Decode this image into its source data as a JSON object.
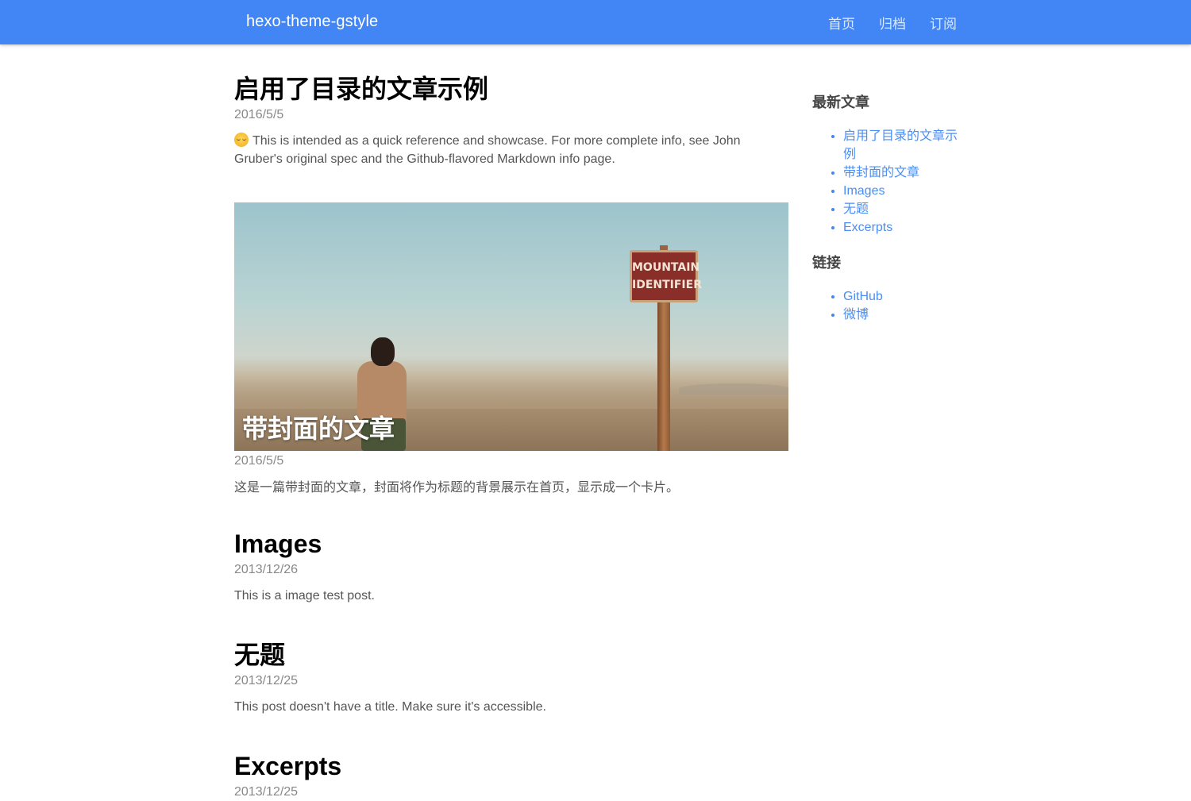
{
  "header": {
    "brand": "hexo-theme-gstyle",
    "nav": [
      "首页",
      "归档",
      "订阅"
    ],
    "accent_color": "#4285f4"
  },
  "posts": [
    {
      "title": "启用了目录的文章示例",
      "date": "2016/5/5",
      "excerpt": "This is intended as a quick reference and showcase. For more complete info, see John Gruber's original spec and the Github-flavored Markdown info page.",
      "emoji_icon": "relieved-face-icon"
    },
    {
      "title": "带封面的文章",
      "date": "2016/5/5",
      "excerpt": "这是一篇带封面的文章，封面将作为标题的背景展示在首页，显示成一个卡片。",
      "cover": {
        "sign_line1": "MOUNTAIN",
        "sign_line2": "IDENTIFIER"
      }
    },
    {
      "title": "Images",
      "date": "2013/12/26",
      "excerpt": "This is a image test post."
    },
    {
      "title": "无题",
      "date": "2013/12/25",
      "excerpt": "This post doesn't have a title. Make sure it's accessible."
    },
    {
      "title": "Excerpts",
      "date": "2013/12/25"
    }
  ],
  "sidebar": {
    "recent_title": "最新文章",
    "recent": [
      "启用了目录的文章示例",
      "带封面的文章",
      "Images",
      "无题",
      "Excerpts"
    ],
    "links_title": "链接",
    "links": [
      "GitHub",
      "微博"
    ]
  }
}
